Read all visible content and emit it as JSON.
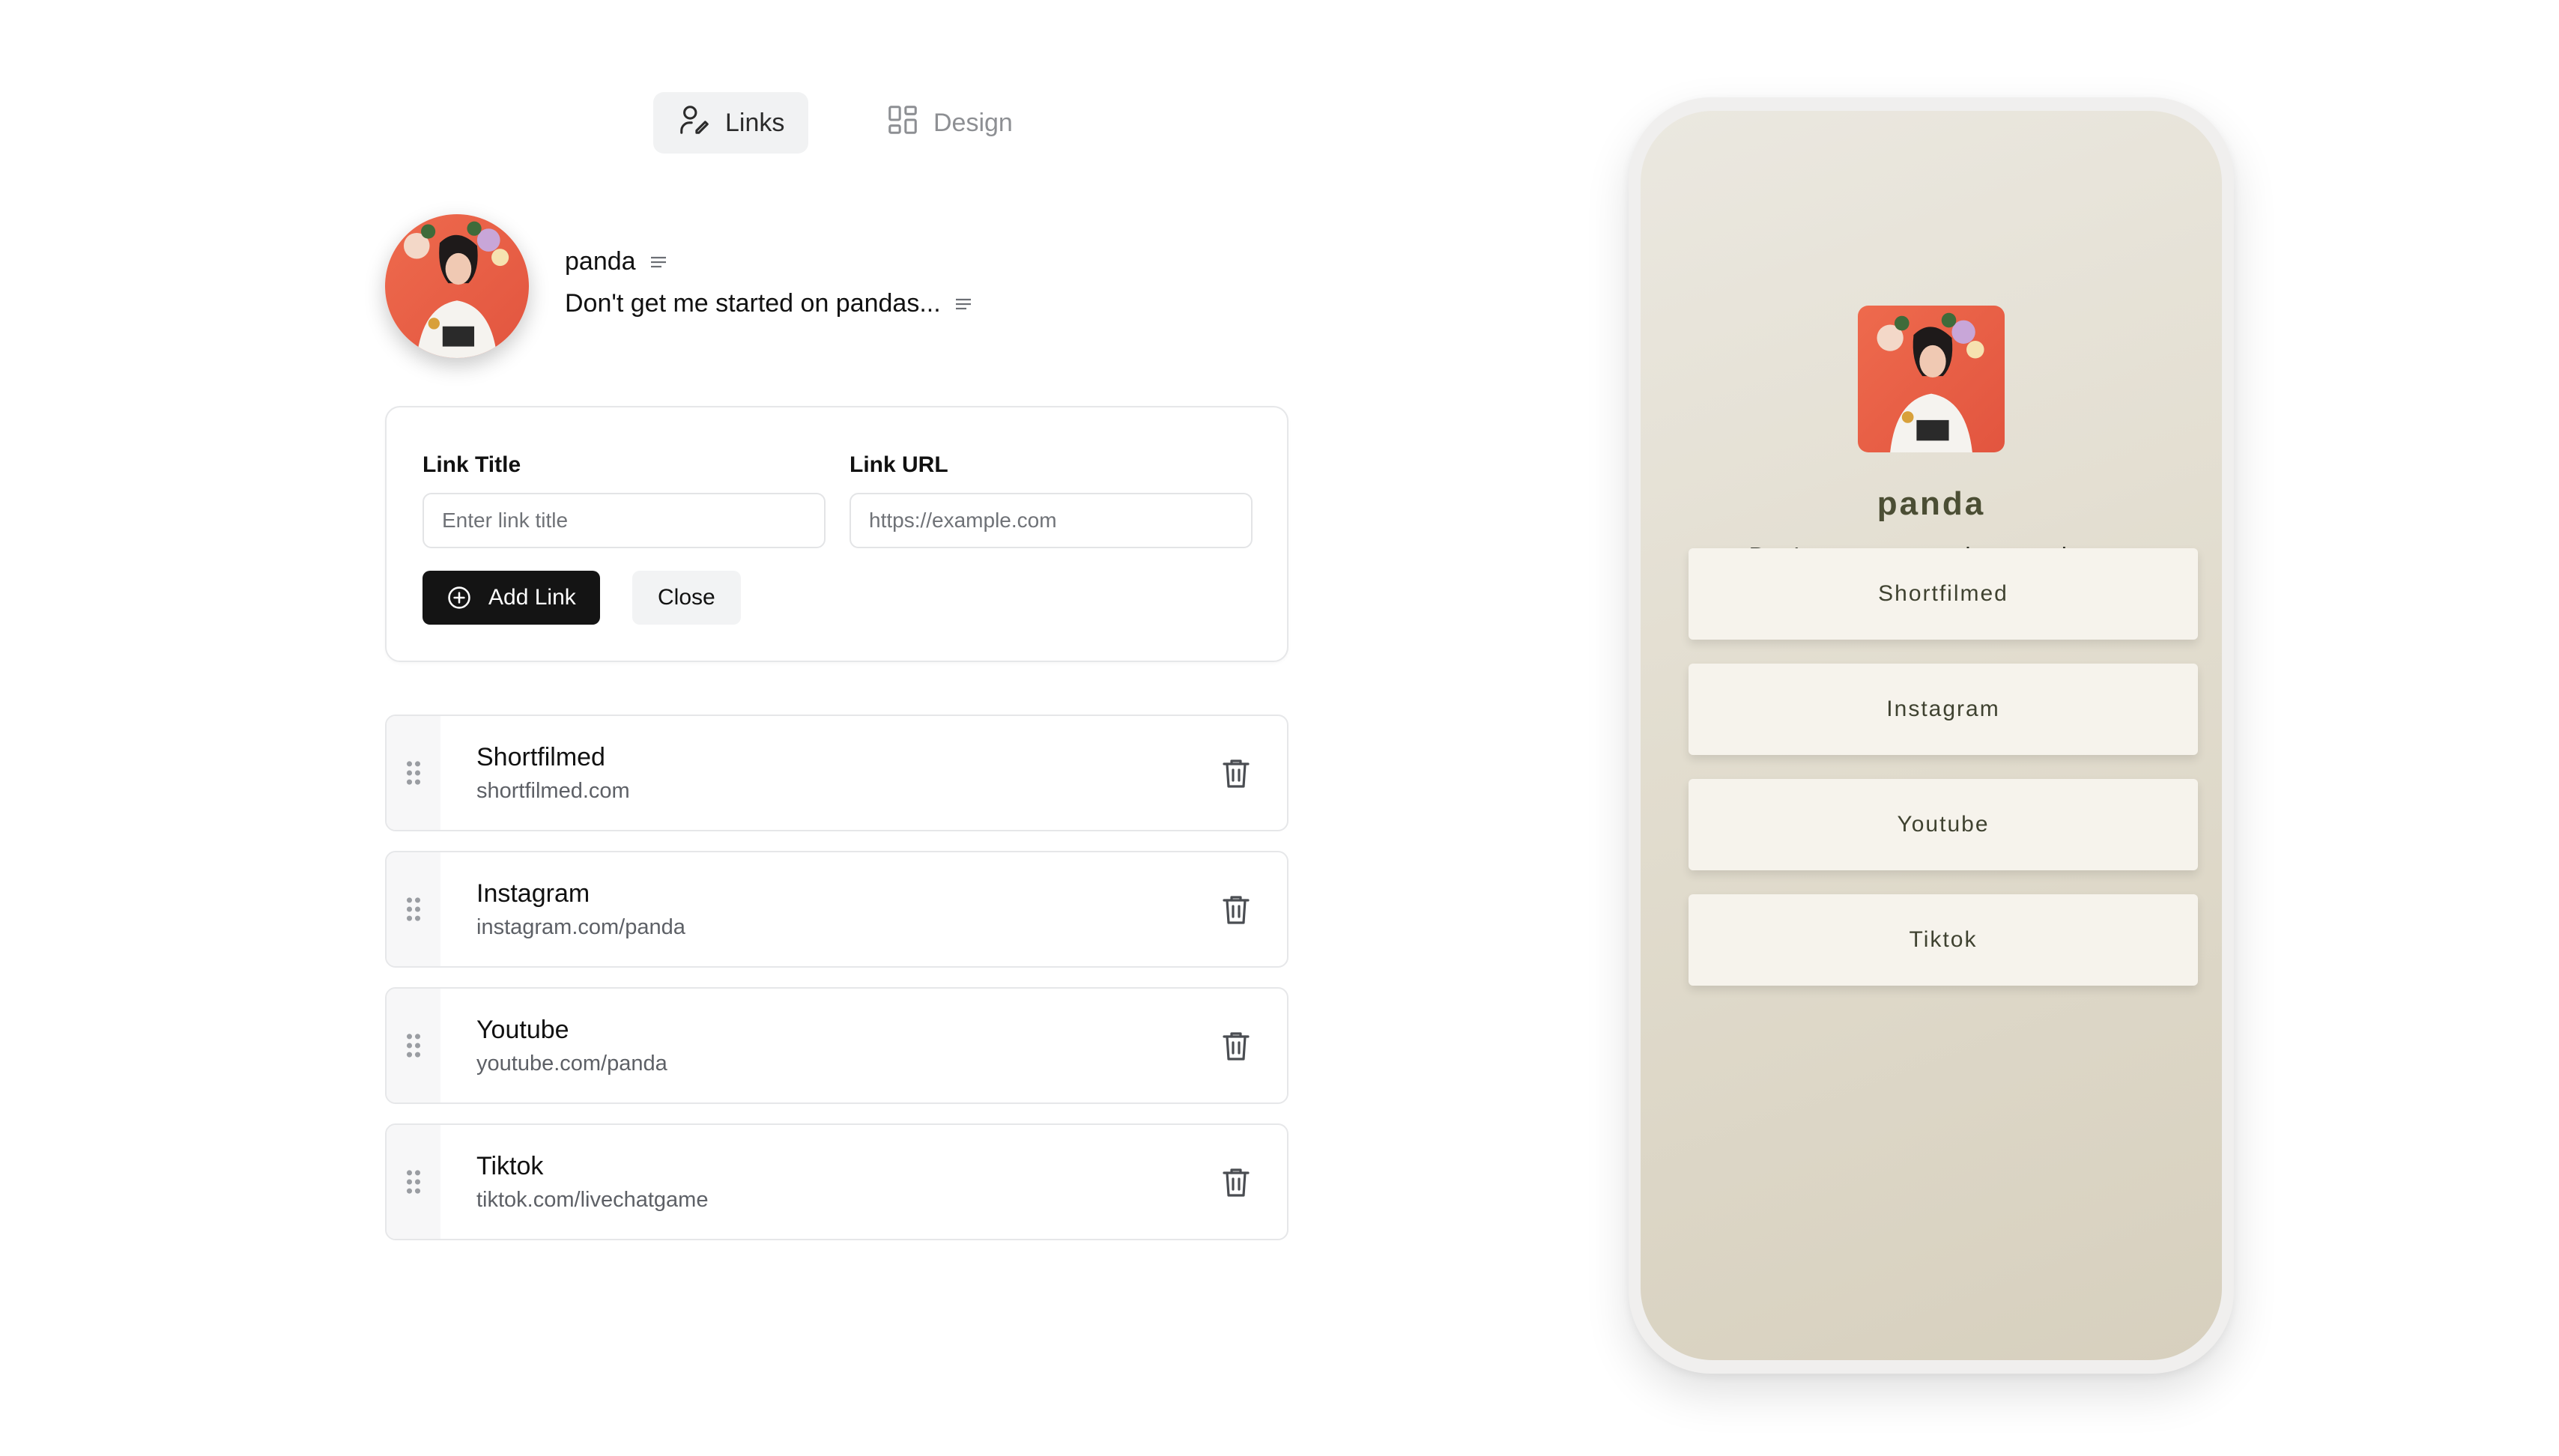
{
  "tabs": [
    {
      "label": "Links",
      "icon": "user-edit-icon",
      "active": true
    },
    {
      "label": "Design",
      "icon": "layout-grid-icon",
      "active": false
    }
  ],
  "profile": {
    "name": "panda",
    "bio": "Don't get me started on pandas...",
    "edit_icon": "text-lines-icon"
  },
  "form": {
    "title_label": "Link Title",
    "title_placeholder": "Enter link title",
    "url_label": "Link URL",
    "url_placeholder": "https://example.com",
    "add_label": "Add Link",
    "close_label": "Close"
  },
  "links": [
    {
      "title": "Shortfilmed",
      "url": "shortfilmed.com"
    },
    {
      "title": "Instagram",
      "url": "instagram.com/panda"
    },
    {
      "title": "Youtube",
      "url": "youtube.com/panda"
    },
    {
      "title": "Tiktok",
      "url": "tiktok.com/livechatgame"
    }
  ],
  "preview": {
    "name": "panda",
    "bio": "Don't get me started on pandas...",
    "buttons": [
      "Shortfilmed",
      "Instagram",
      "Youtube",
      "Tiktok"
    ]
  },
  "colors": {
    "primary_button": "#141414",
    "preview_name": "#4b4e34",
    "preview_bg": "#e2ddcf",
    "preview_button": "#f6f3ec"
  }
}
